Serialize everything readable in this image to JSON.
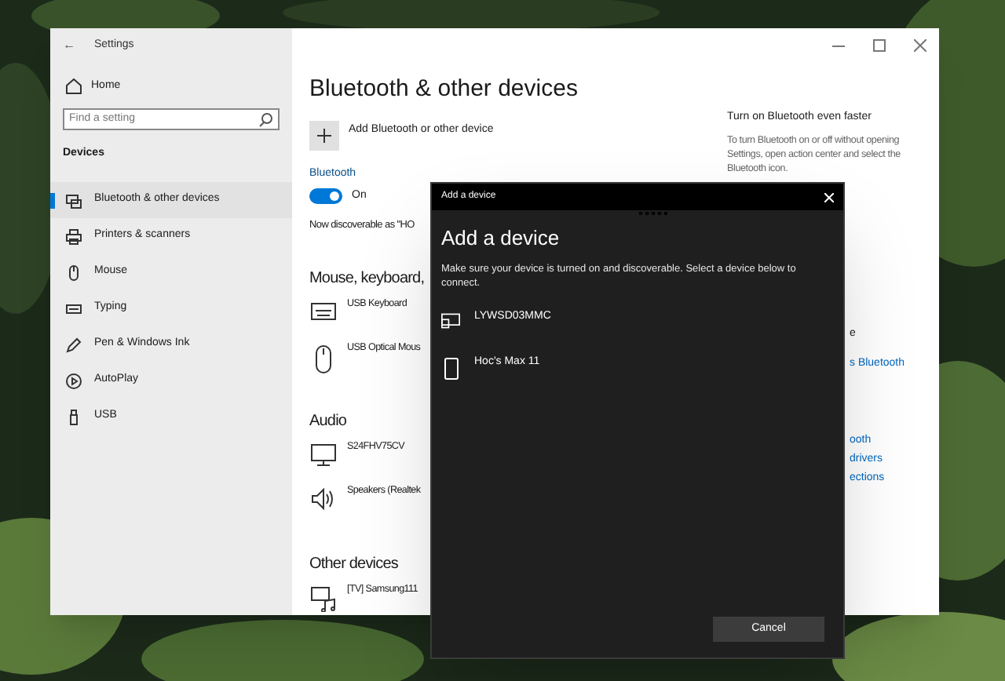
{
  "window": {
    "back": "←",
    "title": "Settings"
  },
  "sidebar": {
    "home": "Home",
    "search": {
      "placeholder": "Find a setting"
    },
    "section": "Devices",
    "items": [
      {
        "kind": "devices",
        "label": "Bluetooth & other devices",
        "selected": true
      },
      {
        "kind": "printer",
        "label": "Printers & scanners",
        "selected": false
      },
      {
        "kind": "mouse",
        "label": "Mouse",
        "selected": false
      },
      {
        "kind": "keyboard",
        "label": "Typing",
        "selected": false
      },
      {
        "kind": "pen",
        "label": "Pen & Windows Ink",
        "selected": false
      },
      {
        "kind": "autoplay",
        "label": "AutoPlay",
        "selected": false
      },
      {
        "kind": "usb",
        "label": "USB",
        "selected": false
      }
    ]
  },
  "page": {
    "title": "Bluetooth & other devices",
    "add_button": "Add Bluetooth or other device",
    "bluetooth": {
      "label": "Bluetooth",
      "on": true,
      "state_text": "On"
    },
    "discoverable": "Now discoverable as \"HO",
    "groups": [
      {
        "heading": "Mouse, keyboard,",
        "devices": [
          {
            "kind": "keyboard",
            "name": "USB Keyboard"
          },
          {
            "kind": "mouse",
            "name": "USB Optical Mous"
          }
        ]
      },
      {
        "heading": "Audio",
        "devices": [
          {
            "kind": "monitor",
            "name": "S24FHV75CV"
          },
          {
            "kind": "speaker",
            "name": "Speakers (Realtek"
          }
        ]
      },
      {
        "heading": "Other devices",
        "devices": [
          {
            "kind": "media",
            "name": "[TV] Samsung111"
          }
        ]
      }
    ]
  },
  "side_panel": {
    "heading": "Turn on Bluetooth even faster",
    "text": "To turn Bluetooth on or off without opening Settings, open action center and select the Bluetooth icon.",
    "fragments": [
      {
        "kind": "text",
        "text": "e"
      },
      {
        "kind": "link",
        "text": "s Bluetooth"
      },
      {
        "kind": "link",
        "text": "ooth"
      },
      {
        "kind": "link",
        "text": "drivers"
      },
      {
        "kind": "link",
        "text": "ections"
      }
    ]
  },
  "dialog": {
    "title": "Add a device",
    "heading": "Add a device",
    "instructions": "Make sure your device is turned on and discoverable. Select a device below to connect.",
    "devices": [
      {
        "kind": "display",
        "name": "LYWSD03MMC"
      },
      {
        "kind": "phone",
        "name": "Hoc's Max 11"
      }
    ],
    "cancel": "Cancel"
  }
}
